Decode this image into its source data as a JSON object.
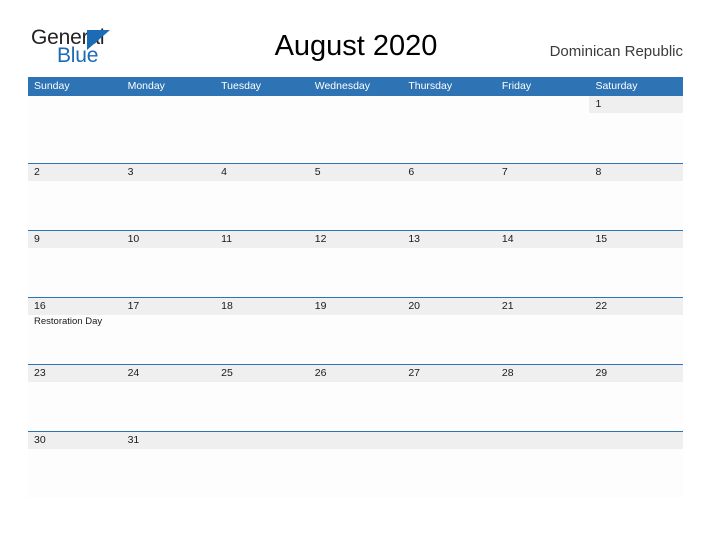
{
  "brand": {
    "name_part1": "General",
    "name_part2": "Blue",
    "color_dark": "#231f20",
    "color_blue": "#1c6cb5"
  },
  "header": {
    "title": "August 2020",
    "locale": "Dominican Republic"
  },
  "theme": {
    "header_blue": "#2e74b5",
    "row_divider": "#2e74b5",
    "date_band": "#efefef",
    "cell_background": "#fdfdfd",
    "page_background": "#ffffff"
  },
  "calendar": {
    "month": "August",
    "year": "2020",
    "weekdays": [
      "Sunday",
      "Monday",
      "Tuesday",
      "Wednesday",
      "Thursday",
      "Friday",
      "Saturday"
    ],
    "weeks": [
      [
        {
          "num": "",
          "event": "",
          "blank": true
        },
        {
          "num": "",
          "event": "",
          "blank": true
        },
        {
          "num": "",
          "event": "",
          "blank": true
        },
        {
          "num": "",
          "event": "",
          "blank": true
        },
        {
          "num": "",
          "event": "",
          "blank": true
        },
        {
          "num": "",
          "event": "",
          "blank": true
        },
        {
          "num": "1",
          "event": "",
          "blank": false
        }
      ],
      [
        {
          "num": "2",
          "event": "",
          "blank": false
        },
        {
          "num": "3",
          "event": "",
          "blank": false
        },
        {
          "num": "4",
          "event": "",
          "blank": false
        },
        {
          "num": "5",
          "event": "",
          "blank": false
        },
        {
          "num": "6",
          "event": "",
          "blank": false
        },
        {
          "num": "7",
          "event": "",
          "blank": false
        },
        {
          "num": "8",
          "event": "",
          "blank": false
        }
      ],
      [
        {
          "num": "9",
          "event": "",
          "blank": false
        },
        {
          "num": "10",
          "event": "",
          "blank": false
        },
        {
          "num": "11",
          "event": "",
          "blank": false
        },
        {
          "num": "12",
          "event": "",
          "blank": false
        },
        {
          "num": "13",
          "event": "",
          "blank": false
        },
        {
          "num": "14",
          "event": "",
          "blank": false
        },
        {
          "num": "15",
          "event": "",
          "blank": false
        }
      ],
      [
        {
          "num": "16",
          "event": "Restoration Day",
          "blank": false
        },
        {
          "num": "17",
          "event": "",
          "blank": false
        },
        {
          "num": "18",
          "event": "",
          "blank": false
        },
        {
          "num": "19",
          "event": "",
          "blank": false
        },
        {
          "num": "20",
          "event": "",
          "blank": false
        },
        {
          "num": "21",
          "event": "",
          "blank": false
        },
        {
          "num": "22",
          "event": "",
          "blank": false
        }
      ],
      [
        {
          "num": "23",
          "event": "",
          "blank": false
        },
        {
          "num": "24",
          "event": "",
          "blank": false
        },
        {
          "num": "25",
          "event": "",
          "blank": false
        },
        {
          "num": "26",
          "event": "",
          "blank": false
        },
        {
          "num": "27",
          "event": "",
          "blank": false
        },
        {
          "num": "28",
          "event": "",
          "blank": false
        },
        {
          "num": "29",
          "event": "",
          "blank": false
        }
      ],
      [
        {
          "num": "30",
          "event": "",
          "blank": false
        },
        {
          "num": "31",
          "event": "",
          "blank": false
        },
        {
          "num": "",
          "event": "",
          "blank": false
        },
        {
          "num": "",
          "event": "",
          "blank": false
        },
        {
          "num": "",
          "event": "",
          "blank": false
        },
        {
          "num": "",
          "event": "",
          "blank": false
        },
        {
          "num": "",
          "event": "",
          "blank": false
        }
      ]
    ]
  }
}
